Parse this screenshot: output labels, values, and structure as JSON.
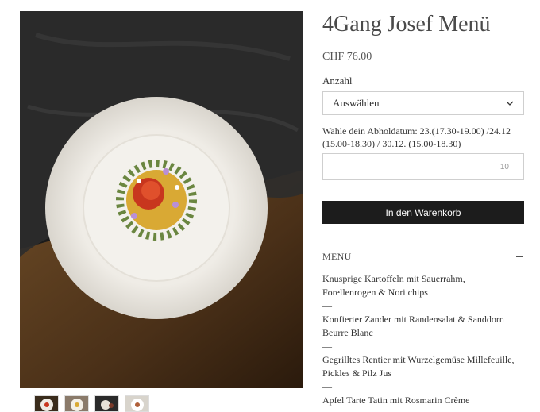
{
  "product": {
    "title": "4Gang Josef Menü",
    "price": "CHF 76.00",
    "quantity_label": "Anzahl",
    "quantity_select": "Auswählen",
    "date_label": "Wahle dein Abholdatum: 23.(17.30-19.00) /24.12 (15.00-18.30) / 30.12. (15.00-18.30)",
    "date_counter": "10",
    "add_to_cart": "In den Warenkorb"
  },
  "menu": {
    "header": "MENU",
    "lines": [
      "Knusprige Kartoffeln mit Sauerrahm,",
      "Forellenrogen & Nori chips",
      "—",
      "Konfierter Zander mit Randensalat & Sanddorn",
      "Beurre Blanc",
      "—",
      "Gegrilltes Rentier mit Wurzelgemüse Millefeuille,",
      "Pickles & Pilz Jus",
      "—",
      "Apfel Tarte Tatin mit Rosmarin Crème"
    ]
  },
  "icons": {
    "chevron": "chevron-down-icon",
    "collapse": "minus-icon"
  },
  "colors": {
    "button_bg": "#1c1c1c",
    "title": "#4a4a4a",
    "border": "#cfcfcf"
  }
}
